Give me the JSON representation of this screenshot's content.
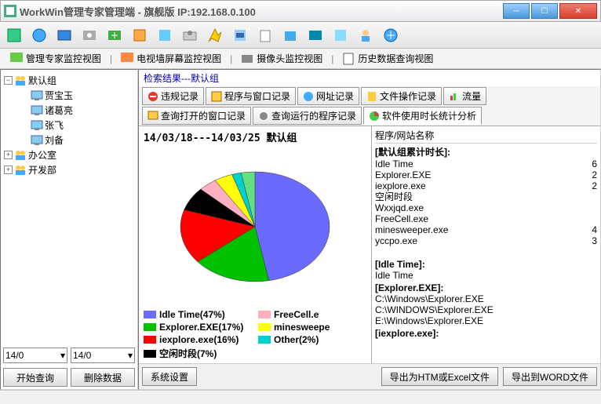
{
  "window": {
    "title": "WorkWin管理专家管理端 - 旗舰版 IP:192.168.0.100"
  },
  "view_tabs": [
    {
      "label": "管理专家监控视图"
    },
    {
      "label": "电视墙屏幕监控视图"
    },
    {
      "label": "摄像头监控视图"
    },
    {
      "label": "历史数据查询视图"
    }
  ],
  "tree": {
    "root": "默认组",
    "children": [
      "贾宝玉",
      "诸葛亮",
      "张飞",
      "刘备"
    ],
    "siblings": [
      "办公室",
      "开发部"
    ]
  },
  "date": {
    "from": "14/0",
    "to": "14/0"
  },
  "left_buttons": {
    "start": "开始查询",
    "delete": "删除数据"
  },
  "search_result": "检索结果---默认组",
  "record_tabs1": [
    {
      "label": "违规记录"
    },
    {
      "label": "程序与窗口记录"
    },
    {
      "label": "网址记录"
    },
    {
      "label": "文件操作记录"
    },
    {
      "label": "流量"
    }
  ],
  "record_tabs2": [
    {
      "label": "查询打开的窗口记录"
    },
    {
      "label": "查询运行的程序记录"
    },
    {
      "label": "软件使用时长统计分析"
    }
  ],
  "chart_title": "14/03/18---14/03/25  默认组",
  "chart_data": {
    "type": "pie",
    "title": "14/03/18---14/03/25  默认组",
    "series": [
      {
        "name": "Idle Time",
        "value": 47,
        "color": "#6a6aff"
      },
      {
        "name": "Explorer.EXE",
        "value": 17,
        "color": "#00c000"
      },
      {
        "name": "iexplore.exe",
        "value": 16,
        "color": "#ff0000"
      },
      {
        "name": "空闲时段",
        "value": 7,
        "color": "#000000"
      },
      {
        "name": "FreeCell.exe",
        "value": 4,
        "color": "#ffb0c0"
      },
      {
        "name": "minesweeper.exe",
        "value": 4,
        "color": "#ffff00"
      },
      {
        "name": "Other",
        "value": 2,
        "color": "#00d0d0"
      },
      {
        "name": "_fill",
        "value": 3,
        "color": "#60e080"
      }
    ],
    "legend_left": [
      {
        "label": "Idle Time(47%)",
        "color": "#6a6aff"
      },
      {
        "label": "Explorer.EXE(17%)",
        "color": "#00c000"
      },
      {
        "label": "iexplore.exe(16%)",
        "color": "#ff0000"
      },
      {
        "label": "空闲时段(7%)",
        "color": "#000000"
      }
    ],
    "legend_right": [
      {
        "label": "FreeCell.e",
        "color": "#ffb0c0"
      },
      {
        "label": "minesweepe",
        "color": "#ffff00"
      },
      {
        "label": "Other(2%)",
        "color": "#00d0d0"
      }
    ]
  },
  "list_header": "程序/网站名称",
  "list": [
    {
      "type": "section",
      "text": "[默认组累计时长]:"
    },
    {
      "type": "row",
      "text": "Idle Time",
      "val": "6"
    },
    {
      "type": "row",
      "text": "Explorer.EXE",
      "val": "2"
    },
    {
      "type": "row",
      "text": "iexplore.exe",
      "val": "2"
    },
    {
      "type": "row",
      "text": "空闲时段",
      "val": ""
    },
    {
      "type": "row",
      "text": "Wxxjqd.exe",
      "val": ""
    },
    {
      "type": "row",
      "text": "FreeCell.exe",
      "val": ""
    },
    {
      "type": "row",
      "text": "minesweeper.exe",
      "val": "4"
    },
    {
      "type": "row",
      "text": "yccpo.exe",
      "val": "3"
    },
    {
      "type": "blank"
    },
    {
      "type": "section",
      "text": "[Idle Time]:"
    },
    {
      "type": "row",
      "text": "Idle Time",
      "val": ""
    },
    {
      "type": "section",
      "text": "[Explorer.EXE]:"
    },
    {
      "type": "row",
      "text": "C:\\Windows\\Explorer.EXE",
      "val": ""
    },
    {
      "type": "row",
      "text": "C:\\WINDOWS\\Explorer.EXE",
      "val": ""
    },
    {
      "type": "row",
      "text": "E:\\Windows\\Explorer.EXE",
      "val": ""
    },
    {
      "type": "section",
      "text": "[iexplore.exe]:"
    }
  ],
  "bottom_buttons": {
    "sys": "系统设置",
    "export_htm": "导出为HTM或Excel文件",
    "export_word": "导出到WORD文件"
  }
}
